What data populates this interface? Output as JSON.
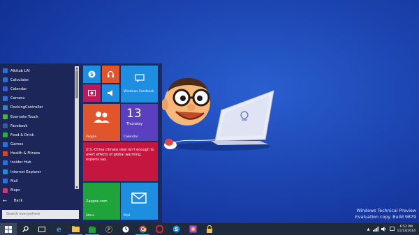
{
  "start_menu": {
    "apps": [
      {
        "label": "Alkitab LAI",
        "icon": "bible-icon",
        "color": "#2e6fd6"
      },
      {
        "label": "Calculator",
        "icon": "calculator-icon",
        "color": "#2e6fd6"
      },
      {
        "label": "Calendar",
        "icon": "calendar-icon",
        "color": "#3c5ec9"
      },
      {
        "label": "Camera",
        "icon": "camera-icon",
        "color": "#2e6fd6"
      },
      {
        "label": "DockingController",
        "icon": "docking-icon",
        "color": "#3b82c4"
      },
      {
        "label": "Evernote Touch",
        "icon": "evernote-icon",
        "color": "#4caf50"
      },
      {
        "label": "Facebook",
        "icon": "facebook-icon",
        "color": "#3b5998"
      },
      {
        "label": "Food & Drink",
        "icon": "food-icon",
        "color": "#2fa84f"
      },
      {
        "label": "Games",
        "icon": "games-icon",
        "color": "#2e6fd6"
      },
      {
        "label": "Health & Fitness",
        "icon": "health-icon",
        "color": "#d9472b"
      },
      {
        "label": "Insider Hub",
        "icon": "insider-hub-icon",
        "color": "#2e6fd6"
      },
      {
        "label": "Internet Explorer",
        "icon": "ie-icon",
        "color": "#1e8fe0"
      },
      {
        "label": "Mail",
        "icon": "mail-icon",
        "color": "#2e6fd6"
      },
      {
        "label": "Maps",
        "icon": "maps-icon",
        "color": "#c23b7a"
      }
    ],
    "back_label": "Back",
    "search_placeholder": "Search everywhere",
    "tiles": {
      "windows_feedback": "Windows Feedback",
      "people": "People",
      "calendar_day": "13",
      "calendar_weekday": "Thursday",
      "calendar_label": "Calendar",
      "news_headline": "U.S.-China climate deal isn't enough to avert effects of global warming, experts say",
      "store_text": "Zappos.com",
      "store_label": "Store",
      "mail_label": "Mail"
    }
  },
  "watermark": {
    "line1": "Windows Technical Preview",
    "line2": "Evaluation copy. Build 9879"
  },
  "taskbar": {
    "time": "6:52 PM",
    "date": "11/13/2014",
    "accent": "#1f2a3d"
  }
}
